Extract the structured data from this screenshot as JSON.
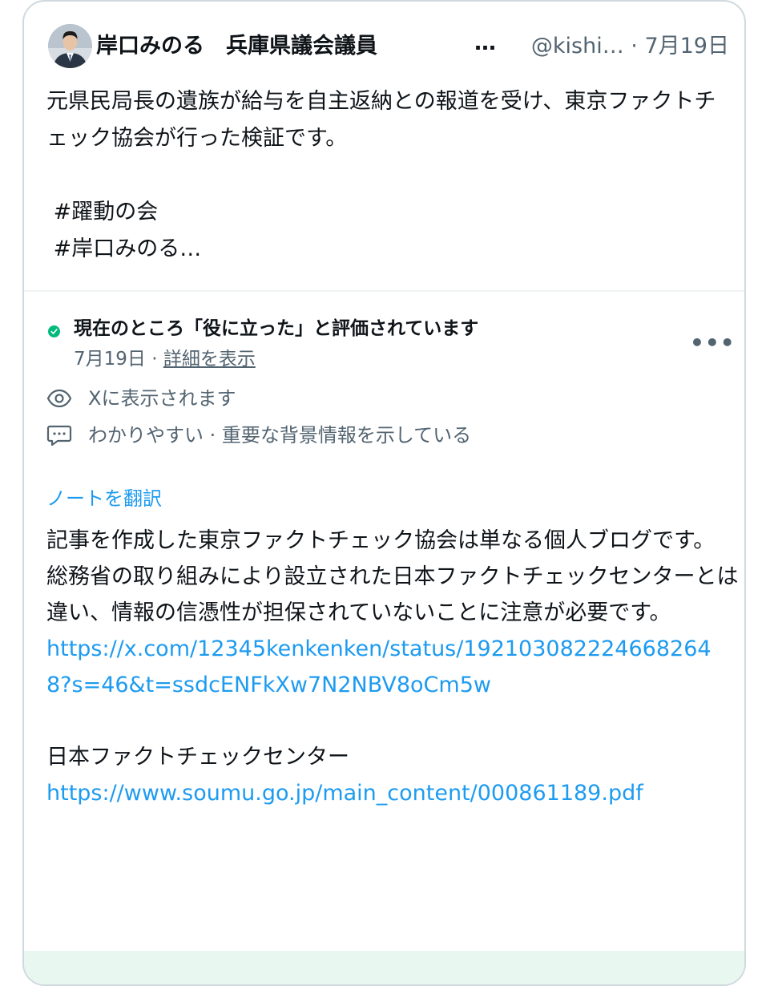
{
  "tweet": {
    "author_name": "岸口みのる　兵庫県議会議員",
    "author_more": "…",
    "handle": "@kishi…",
    "separator": " · ",
    "date": "7月19日",
    "text": "元県民局長の遺族が給与を自主返納との報道を受け、東京ファクトチェック協会が行った検証です。\n\n #躍動の会\n #岸口みのる…"
  },
  "community_note": {
    "status_title": "現在のところ「役に立った」と評価されています",
    "status_date": "7月19日",
    "status_separator": " · ",
    "details_link": "詳細を表示",
    "more_label": "•••",
    "shown_on_x": "Xに表示されます",
    "reasons": "わかりやすい · 重要な背景情報を示している",
    "translate_label": "ノートを翻訳",
    "body_line1": "記事を作成した東京ファクトチェック協会は単なる個人ブログです。",
    "body_line2": "総務省の取り組みにより設立された日本ファクトチェックセンターとは違い、情報の信憑性が担保されていないことに注意が必要です。",
    "link1": "https://x.com/12345kenkenken/status/1921030822246682648?s=46&t=ssdcENFkXw7N2NBV8oCm5w",
    "section_title": "日本ファクトチェックセンター",
    "link2": "https://www.soumu.go.jp/main_content/000861189.pdf"
  },
  "colors": {
    "accent_link": "#1d9bf0",
    "status_green": "#00ba7c",
    "secondary_text": "#536471",
    "border": "#cfd9de"
  },
  "icons": {
    "status": "check-circle-icon",
    "shown": "eye-icon",
    "reasons": "comment-icon",
    "more": "more-horizontal-icon"
  }
}
